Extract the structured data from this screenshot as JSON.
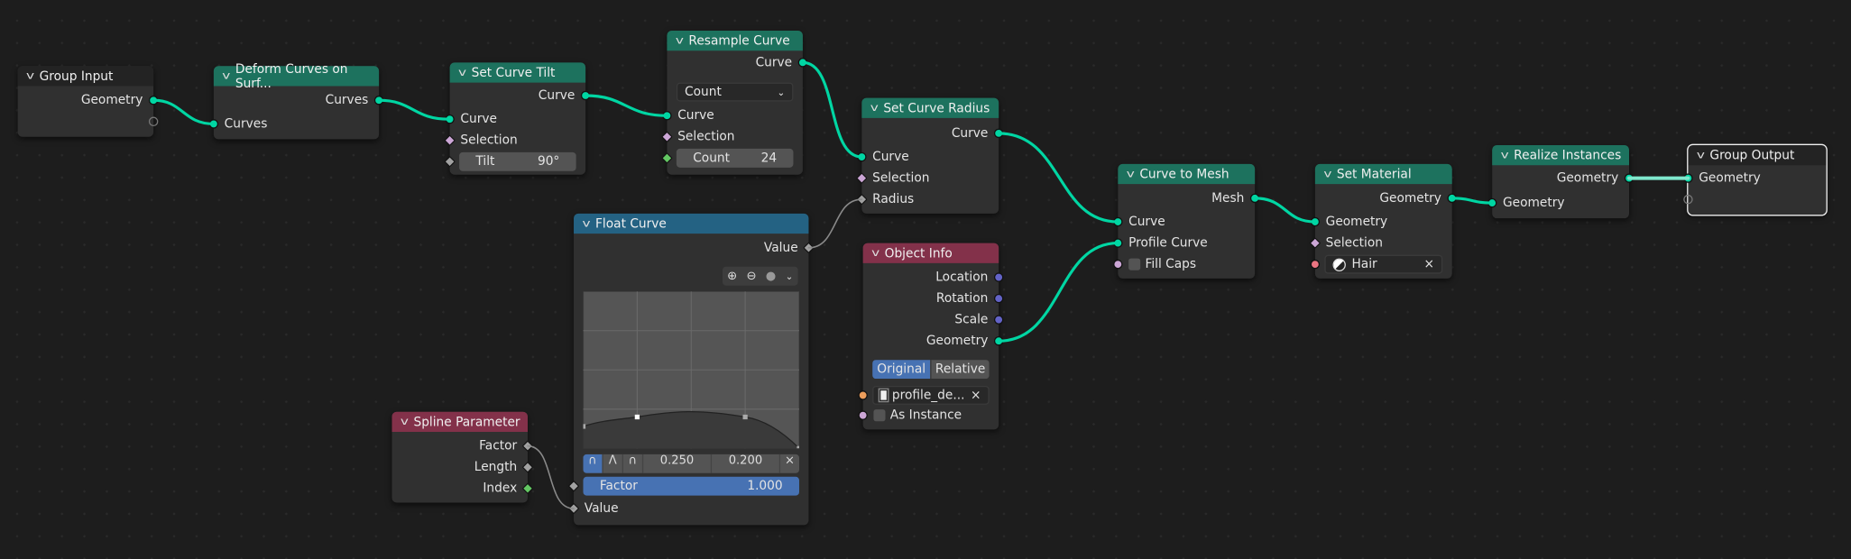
{
  "colors": {
    "geometry": "#00d6a3",
    "header_geometry": "#1d725e",
    "header_converter": "#246283",
    "header_input": "#83314a",
    "field_float": "#a1a1a1",
    "field_selection": "#cca6d6",
    "int": "#63c763",
    "vector": "#6363c7",
    "material": "#eb7582",
    "object": "#ed9e5c",
    "active_button": "#4772b3"
  },
  "nodes": {
    "group_input": {
      "title": "Group Input",
      "outputs": [
        "Geometry"
      ]
    },
    "deform": {
      "title": "Deform Curves on Surf...",
      "outputs": [
        "Curves"
      ],
      "inputs": [
        "Curves"
      ]
    },
    "tilt": {
      "title": "Set Curve Tilt",
      "outputs": [
        "Curve"
      ],
      "inputs": [
        "Curve",
        "Selection"
      ],
      "tilt_label": "Tilt",
      "tilt_value": "90°"
    },
    "resample": {
      "title": "Resample Curve",
      "outputs": [
        "Curve"
      ],
      "mode": "Count",
      "inputs": [
        "Curve",
        "Selection"
      ],
      "count_label": "Count",
      "count_value": "24"
    },
    "radius": {
      "title": "Set Curve Radius",
      "outputs": [
        "Curve"
      ],
      "inputs": [
        "Curve",
        "Selection",
        "Radius"
      ]
    },
    "float_curve": {
      "title": "Float Curve",
      "outputs": [
        "Value"
      ],
      "points": [
        [
          0,
          0.14
        ],
        [
          0.25,
          0.2
        ],
        [
          0.75,
          0.2
        ],
        [
          1,
          0
        ]
      ],
      "selected_x": "0.250",
      "selected_y": "0.200",
      "factor_label": "Factor",
      "factor_value": "1.000",
      "inputs": [
        "Value"
      ],
      "tools": [
        "zoom-in-icon",
        "zoom-out-icon",
        "clip-icon",
        "chevron-down-icon"
      ],
      "handle_types": [
        "auto-handle-icon",
        "vector-handle-icon",
        "auto-clamped-icon"
      ]
    },
    "object_info": {
      "title": "Object Info",
      "outputs": [
        "Location",
        "Rotation",
        "Scale",
        "Geometry"
      ],
      "transform_space": [
        "Original",
        "Relative"
      ],
      "active_space": "Original",
      "object": "profile_de...",
      "as_instance": "As Instance"
    },
    "spline_param": {
      "title": "Spline Parameter",
      "outputs": [
        "Factor",
        "Length",
        "Index"
      ]
    },
    "curve_to_mesh": {
      "title": "Curve to Mesh",
      "outputs": [
        "Mesh"
      ],
      "inputs": [
        "Curve",
        "Profile Curve"
      ],
      "fill_caps": "Fill Caps"
    },
    "set_material": {
      "title": "Set Material",
      "outputs": [
        "Geometry"
      ],
      "inputs": [
        "Geometry",
        "Selection"
      ],
      "material": "Hair"
    },
    "realize": {
      "title": "Realize Instances",
      "outputs": [
        "Geometry"
      ],
      "inputs": [
        "Geometry"
      ]
    },
    "group_output": {
      "title": "Group Output",
      "inputs": [
        "Geometry"
      ]
    }
  }
}
